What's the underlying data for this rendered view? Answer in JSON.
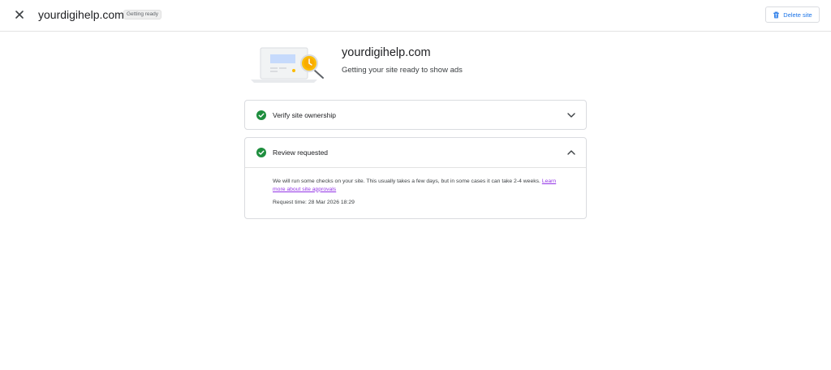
{
  "header": {
    "site_name": "yourdigihelp.com",
    "status_chip": "Getting ready",
    "delete_label": "Delete site"
  },
  "hero": {
    "site_name": "yourdigihelp.com",
    "subtitle": "Getting your site ready to show ads"
  },
  "steps": [
    {
      "title": "Verify site ownership",
      "status": "complete",
      "expanded": false
    },
    {
      "title": "Review requested",
      "status": "complete",
      "expanded": true,
      "body_text": "We will run some checks on your site. This usually takes a few days, but in some cases it can take 2-4 weeks.",
      "link_text": "Learn more about site approvals",
      "request_time": "Request time: 28 Mar 2026 18:29"
    }
  ],
  "colors": {
    "accent_blue": "#1a73e8",
    "success_green": "#1e8e3e",
    "link_purple": "#9334e6",
    "divider": "#e3e3e3"
  },
  "icons": {
    "close": "close-icon",
    "delete": "trash-icon",
    "check": "check-circle-icon",
    "collapsed": "chevron-down-icon",
    "expanded": "chevron-up-icon"
  }
}
